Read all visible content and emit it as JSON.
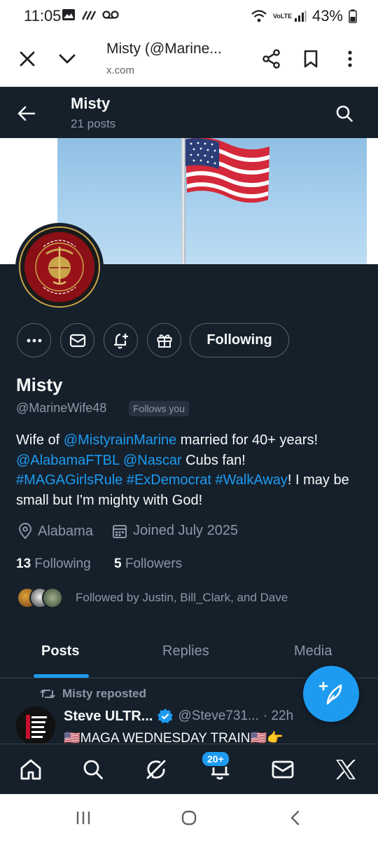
{
  "status_bar": {
    "time": "11:05",
    "network": "VoLTE",
    "battery": "43%"
  },
  "browser": {
    "page_title": "Misty (@Marine...",
    "url": "x.com",
    "icons": [
      "close-icon",
      "chevron-down-icon",
      "share-icon",
      "bookmark-icon",
      "more-vertical-icon"
    ]
  },
  "header": {
    "name": "Misty",
    "post_count": "21 posts"
  },
  "profile": {
    "actions": {
      "follow_label": "Following"
    },
    "display_name": "Misty",
    "handle": "@MarineWife48",
    "follows_you": "Follows you",
    "bio": {
      "p1": "Wife of ",
      "l1": "@MistyrainMarine",
      "p2": " married for 40+ years!",
      "l2": "@AlabamaFTBL",
      "l3": "@Nascar",
      "p3": " Cubs fan!",
      "l4": "#MAGAGirlsRule",
      "l5": "#ExDemocrat",
      "l6": "#WalkAway",
      "p4": "! I may be small but I'm mighty with God!"
    },
    "location": "Alabama",
    "joined": "Joined July 2025",
    "following_count": "13",
    "following_label": "Following",
    "followers_count": "5",
    "followers_label": "Followers",
    "followed_by": "Followed by Justin, Bill_Clark, and Dave"
  },
  "tabs": [
    {
      "label": "Posts",
      "active": true
    },
    {
      "label": "Replies",
      "active": false
    },
    {
      "label": "Media",
      "active": false
    }
  ],
  "feed": {
    "repost_text": "Misty reposted",
    "author": "Steve ULTR...",
    "handle": "@Steve731...",
    "time": "· 22h",
    "text": "🇺🇸MAGA WEDNESDAY TRAIN🇺🇸👉"
  },
  "bottom_nav": {
    "notifications_badge": "20+"
  },
  "colors": {
    "background": "#15202b",
    "accent": "#1d9bf0",
    "text_primary": "#f7f9f9",
    "text_secondary": "#8b98a5"
  }
}
